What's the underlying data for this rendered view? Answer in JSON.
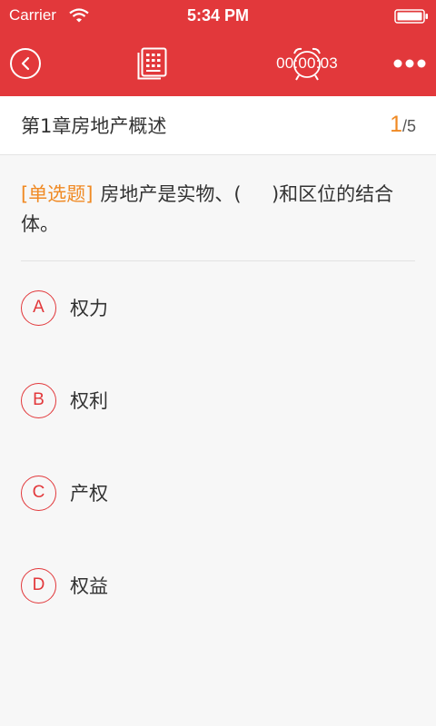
{
  "status_bar": {
    "carrier": "Carrier",
    "time": "5:34 PM"
  },
  "header": {
    "back_icon": "chevron-left-icon",
    "answer_sheet_icon": "document-list-icon",
    "timer_icon": "alarm-clock-icon",
    "timer": "00:00:03",
    "more_icon": "more-dots-icon"
  },
  "chapter": {
    "title": "第1章房地产概述",
    "current": "1",
    "total": "/5"
  },
  "question": {
    "type": "[单选题]",
    "text": "房地产是实物、(     )和区位的结合体。"
  },
  "options": [
    {
      "letter": "A",
      "text": "权力"
    },
    {
      "letter": "B",
      "text": "权利"
    },
    {
      "letter": "C",
      "text": "产权"
    },
    {
      "letter": "D",
      "text": "权益"
    }
  ],
  "colors": {
    "accent": "#e2383b",
    "highlight": "#f08a24"
  }
}
